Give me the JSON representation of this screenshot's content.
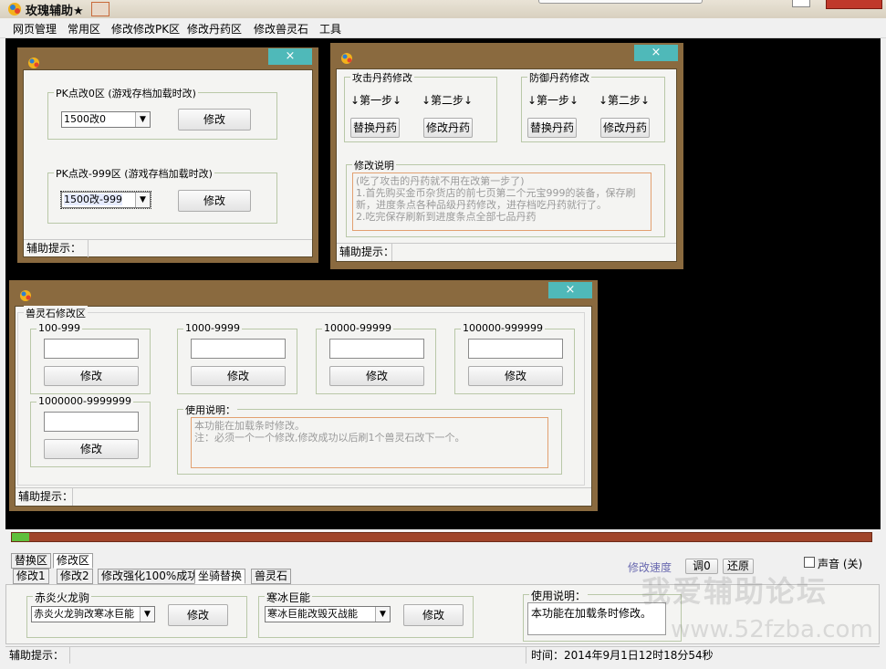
{
  "window": {
    "title": "玫瑰辅助★"
  },
  "menu": [
    "网页管理",
    "常用区",
    "修改修改PK区",
    "修改丹药区",
    "修改兽灵石",
    "工具"
  ],
  "pk_window": {
    "close": "×",
    "group1_label": "PK点改0区 (游戏存档加载时改)",
    "select1": "1500改0",
    "button1": "修改",
    "group2_label": "PK点改-999区 (游戏存档加载时改)",
    "select2": "1500改-999",
    "button2": "修改",
    "hint": "辅助提示："
  },
  "dan_window": {
    "close": "×",
    "attack_label": "攻击丹药修改",
    "defense_label": "防御丹药修改",
    "step1": "↓第一步↓",
    "step2": "↓第二步↓",
    "replace_btn": "替换丹药",
    "modify_btn": "修改丹药",
    "notes_label": "修改说明",
    "notes": [
      "(吃了攻击的丹药就不用在改第一步了)",
      "1.首先购买金币杂货店的前七页第二个元宝999的装备，保存刷新，进度条点各种品级丹药修改，进存档吃丹药就行了。",
      "2.吃完保存刷新到进度条点全部七品丹药"
    ],
    "hint": "辅助提示："
  },
  "stone_window": {
    "close": "×",
    "title": "兽灵石修改区",
    "ranges": [
      "100-999",
      "1000-9999",
      "10000-99999",
      "100000-999999",
      "1000000-9999999"
    ],
    "button": "修改",
    "usage_label": "使用说明：",
    "usage": [
      "本功能在加载条时修改。",
      "注：必须一个一个修改,修改成功以后刷1个兽灵石改下一个。"
    ],
    "hint": "辅助提示："
  },
  "bottom": {
    "tabs_row1": [
      "替换区",
      "修改区"
    ],
    "tabs_row2": [
      "修改1",
      "修改2",
      "修改强化100%成功",
      "坐骑替换",
      "兽灵石"
    ],
    "speed_label": "修改速度",
    "speed_btn": "调0",
    "restore_btn": "还原",
    "sound_label": "声音 (关)",
    "group1_label": "赤炎火龙驹",
    "select1": "赤炎火龙驹改寒冰巨能",
    "button1": "修改",
    "group2_label": "寒冰巨能",
    "select2": "寒冰巨能改毁灭战能",
    "button2": "修改",
    "usage_label": "使用说明：",
    "usage": "本功能在加载条时修改。",
    "hint": "辅助提示：",
    "time": "时间：2014年9月1日12时18分54秒",
    "watermark1": "我爱辅助论坛",
    "watermark2": "www.52fzba.com"
  },
  "progress": {
    "value": 0.02
  },
  "colors": {
    "accent": "#4fb9b9",
    "frame": "#8a6a3f",
    "progress": "#a0452b"
  }
}
